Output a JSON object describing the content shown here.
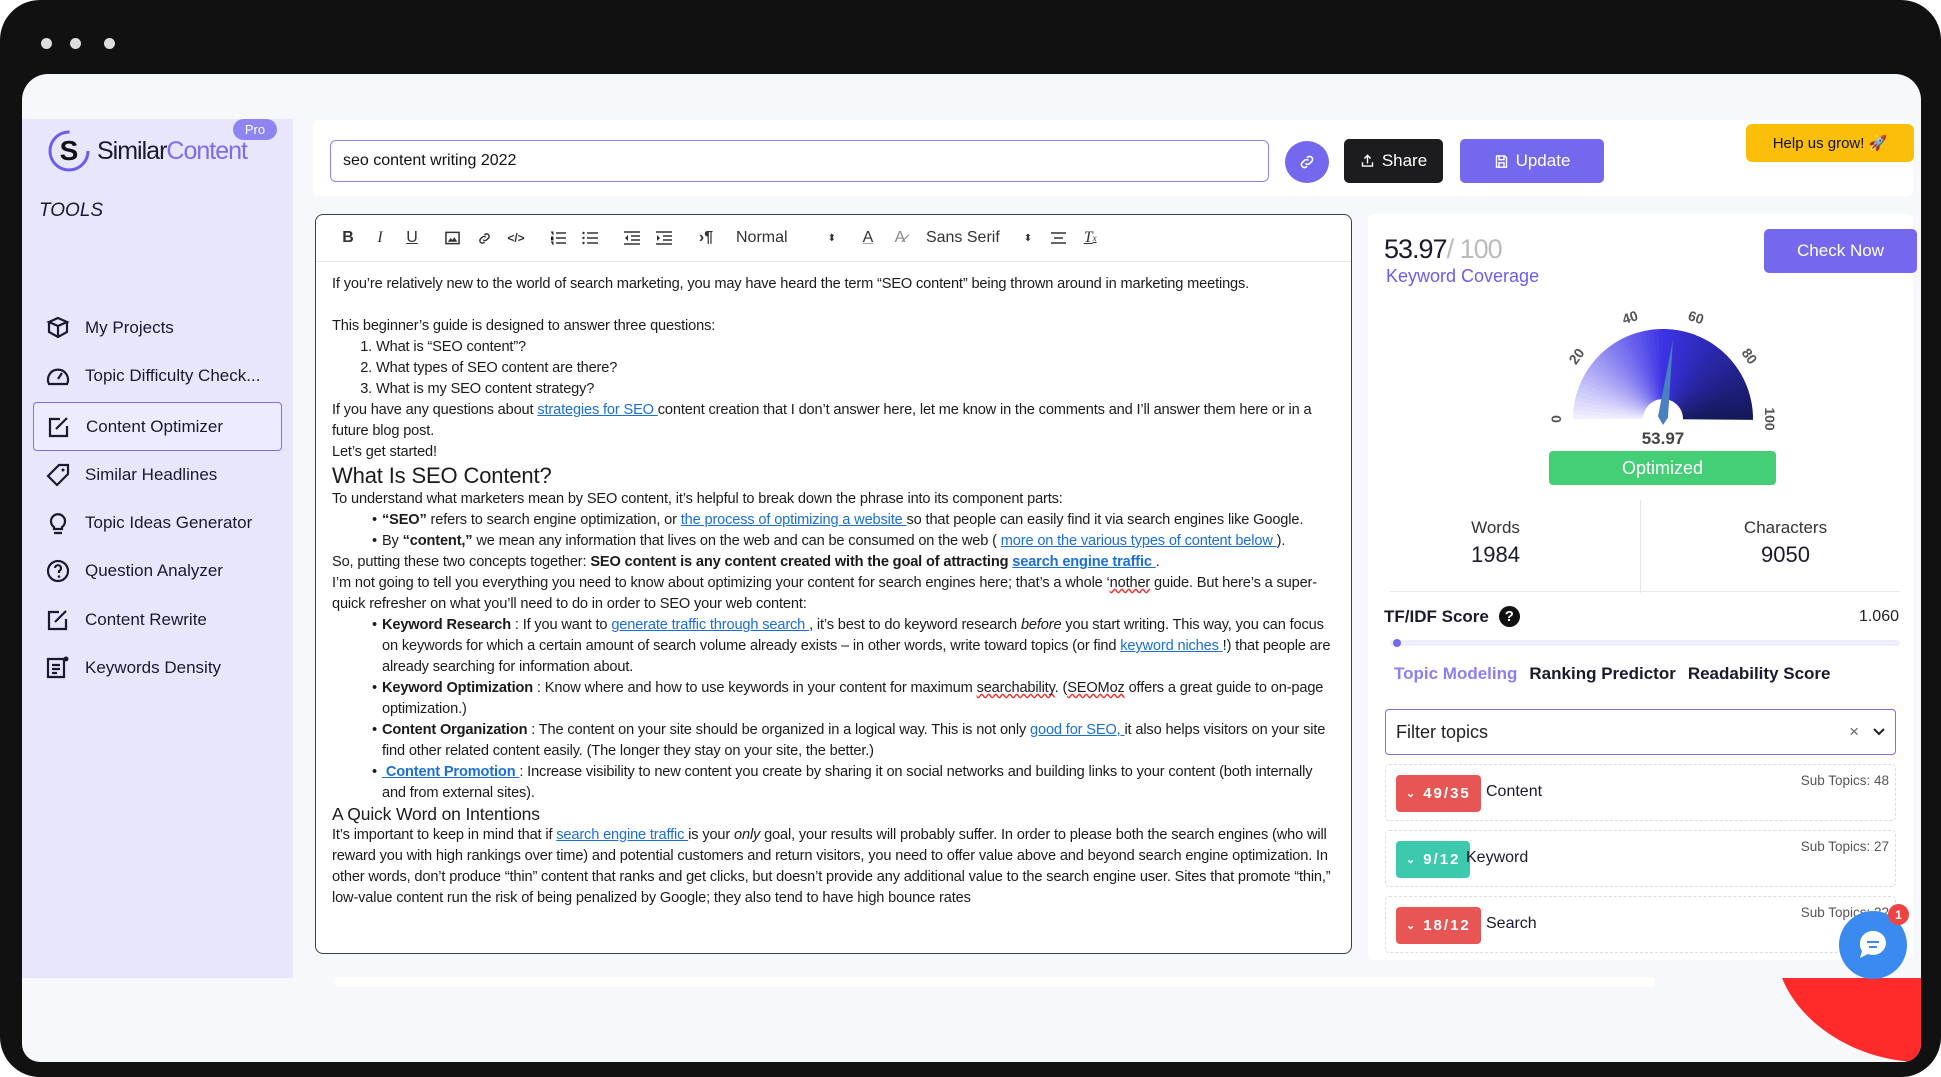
{
  "app": {
    "logo_text_a": "Similar",
    "logo_text_b": "Content",
    "plan_badge": "Pro"
  },
  "sidebar": {
    "section_label": "TOOLS",
    "items": [
      {
        "label": "My Projects",
        "icon": "package-icon"
      },
      {
        "label": "Topic Difficulty Check...",
        "icon": "gauge-icon"
      },
      {
        "label": "Content Optimizer",
        "icon": "edit-icon",
        "active": true
      },
      {
        "label": "Similar Headlines",
        "icon": "tag-icon"
      },
      {
        "label": "Topic Ideas Generator",
        "icon": "lightbulb-icon"
      },
      {
        "label": "Question Analyzer",
        "icon": "question-icon"
      },
      {
        "label": "Content Rewrite",
        "icon": "edit-icon"
      },
      {
        "label": "Keywords Density",
        "icon": "document-icon"
      }
    ]
  },
  "topbar": {
    "keyword_value": "seo content writing 2022",
    "share_label": "Share",
    "update_label": "Update",
    "help_label": "Help us grow! 🚀"
  },
  "toolbar": {
    "format_select": "Normal",
    "font_select": "Sans Serif"
  },
  "editor": {
    "blocks": [
      {
        "type": "p",
        "runs": [
          {
            "t": "If you’re relatively new to the world of search marketing, you may have heard the term “SEO content” being thrown around in marketing meetings."
          }
        ]
      },
      {
        "type": "gap"
      },
      {
        "type": "p",
        "runs": [
          {
            "t": "This beginner’s guide is designed to answer three questions:"
          }
        ]
      },
      {
        "type": "ol",
        "items": [
          [
            {
              "t": "What is “SEO content”?"
            }
          ],
          [
            {
              "t": "What types of SEO content are there?"
            }
          ],
          [
            {
              "t": "What is my SEO content strategy?"
            }
          ]
        ]
      },
      {
        "type": "p",
        "runs": [
          {
            "t": "If you have any questions about "
          },
          {
            "t": " strategies for SEO ",
            "s": "link"
          },
          {
            "t": " content creation that I don’t answer here, let me know in the comments and I’ll answer them here or in a future blog post."
          }
        ]
      },
      {
        "type": "p",
        "runs": [
          {
            "t": "Let’s get started!"
          }
        ]
      },
      {
        "type": "h2",
        "runs": [
          {
            "t": "What Is SEO Content?"
          }
        ]
      },
      {
        "type": "p",
        "runs": [
          {
            "t": "To understand what marketers mean by SEO content, it’s helpful to break down the phrase into its component parts:"
          }
        ]
      },
      {
        "type": "ul",
        "items": [
          [
            {
              "t": "“SEO”",
              "s": "bold"
            },
            {
              "t": "  refers to search engine optimization, or "
            },
            {
              "t": " the process of optimizing a website ",
              "s": "link"
            },
            {
              "t": " so that people can easily find it via search engines like Google."
            }
          ],
          [
            {
              "t": "By  "
            },
            {
              "t": "“content,”",
              "s": "bold"
            },
            {
              "t": "  we mean any information that lives on the web and can be consumed on the web ( "
            },
            {
              "t": " more on the various types of content below ",
              "s": "link"
            },
            {
              "t": " )."
            }
          ]
        ]
      },
      {
        "type": "p",
        "runs": [
          {
            "t": "So, putting these two concepts together:  "
          },
          {
            "t": "SEO content is any content created with the goal of attracting ",
            "s": "bold"
          },
          {
            "t": " search engine traffic ",
            "s": "boldlink"
          },
          {
            "t": " ."
          }
        ]
      },
      {
        "type": "p",
        "runs": [
          {
            "t": "I’m not going to tell you everything you need to know about optimizing your content for search engines here; that’s a whole ‘"
          },
          {
            "t": "nother",
            "s": "sq"
          },
          {
            "t": " guide. But here’s a super-quick refresher on what you’ll need to do in order to SEO your web content:"
          }
        ]
      },
      {
        "type": "ul",
        "items": [
          [
            {
              "t": "Keyword Research",
              "s": "bold"
            },
            {
              "t": "  : If you want to "
            },
            {
              "t": " generate traffic through search ",
              "s": "link"
            },
            {
              "t": " , it’s best to do keyword research  "
            },
            {
              "t": "before",
              "s": "italic"
            },
            {
              "t": "  you start writing. This way, you can focus on keywords for which a certain amount of search volume already exists – in other words, write toward topics (or find "
            },
            {
              "t": " keyword niches ",
              "s": "link"
            },
            {
              "t": " !) that people are already searching for information about."
            }
          ],
          [
            {
              "t": "Keyword Optimization",
              "s": "bold"
            },
            {
              "t": "  : Know where and how to use keywords in your content for maximum "
            },
            {
              "t": "searchability",
              "s": "sq"
            },
            {
              "t": ". ("
            },
            {
              "t": "SEOMoz",
              "s": "sq"
            },
            {
              "t": " offers a great guide to on-page optimization.)"
            }
          ],
          [
            {
              "t": "Content Organization",
              "s": "bold"
            },
            {
              "t": "  : The content on your site should be organized in a logical way. This is not only "
            },
            {
              "t": " good for SEO, ",
              "s": "link"
            },
            {
              "t": " it also helps visitors on your site find other related content easily. (The longer they stay on your site, the better.)"
            }
          ],
          [
            {
              "t": " Content Promotion ",
              "s": "boldlink"
            },
            {
              "t": " : Increase visibility to new content you create by sharing it on social networks and building links to your content (both internally and from external sites)."
            }
          ]
        ]
      },
      {
        "type": "h3",
        "runs": [
          {
            "t": "A Quick Word on Intentions"
          }
        ]
      },
      {
        "type": "p",
        "runs": [
          {
            "t": "It’s important to keep in mind that if "
          },
          {
            "t": " search engine traffic ",
            "s": "link"
          },
          {
            "t": " is your  "
          },
          {
            "t": "only",
            "s": "italic"
          },
          {
            "t": "  goal, your results will probably suffer. In order to please both the search engines (who will reward you with high rankings over time) and potential customers and return visitors, you need to offer value above and beyond search engine optimization. In other words, don’t produce “thin” content that ranks and get clicks, but doesn’t provide any additional value to the search engine user. Sites that promote “thin,” low-value content run the risk of being penalized by Google; they also tend to have high bounce rates"
          }
        ]
      }
    ]
  },
  "panel": {
    "score": "53.97",
    "score_max": "/ 100",
    "score_label": "Keyword Coverage",
    "check_label": "Check Now",
    "gauge": {
      "value": 53.97,
      "min": 0,
      "max": 100,
      "ticks": [
        "0",
        "20",
        "40",
        "60",
        "80",
        "100"
      ],
      "value_label": "53.97"
    },
    "status_label": "Optimized",
    "words_label": "Words",
    "words_value": "1984",
    "chars_label": "Characters",
    "chars_value": "9050",
    "tfidf_label": "TF/IDF Score",
    "tfidf_help": "?",
    "tfidf_value": "1.060",
    "tfidf_progress": 0.01,
    "tabs": [
      "Topic Modeling",
      "Ranking Predictor",
      "Readability Score"
    ],
    "filter_placeholder": "Filter topics",
    "topics": [
      {
        "badge": "49/35",
        "name": "Content",
        "sub": "Sub Topics: 48",
        "color": "#e85555"
      },
      {
        "badge": "9/12",
        "name": "Keyword",
        "sub": "Sub Topics: 27",
        "color": "#3cc9ad"
      },
      {
        "badge": "18/12",
        "name": "Search",
        "sub": "Sub Topics: 22",
        "color": "#e85555"
      }
    ]
  },
  "chat": {
    "notifications": "1"
  },
  "colors": {
    "accent": "#7468ef",
    "sidebar_bg": "#e8e6fc",
    "optimized": "#44cf77",
    "help": "#fbbf09"
  }
}
